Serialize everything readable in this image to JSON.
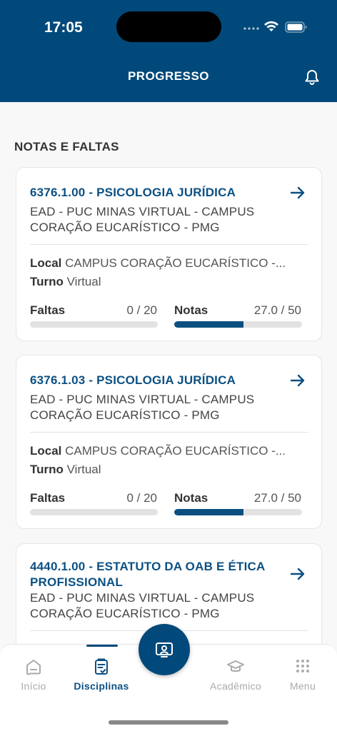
{
  "status_bar": {
    "time": "17:05"
  },
  "header": {
    "title": "PROGRESSO"
  },
  "section": {
    "title": "NOTAS E FALTAS"
  },
  "cards": [
    {
      "code_title": "6376.1.00 - PSICOLOGIA JURÍDICA",
      "campus": "EAD - PUC MINAS VIRTUAL - CAMPUS CORAÇÃO EUCARÍSTICO - PMG",
      "local_label": "Local",
      "local_value": "CAMPUS CORAÇÃO EUCARÍSTICO -...",
      "turno_label": "Turno",
      "turno_value": "Virtual",
      "faltas_label": "Faltas",
      "faltas_value": "0 / 20",
      "faltas_fraction": 0,
      "notas_label": "Notas",
      "notas_value": "27.0 / 50",
      "notas_fraction": 0.54
    },
    {
      "code_title": "6376.1.03 - PSICOLOGIA JURÍDICA",
      "campus": "EAD - PUC MINAS VIRTUAL - CAMPUS CORAÇÃO EUCARÍSTICO - PMG",
      "local_label": "Local",
      "local_value": "CAMPUS CORAÇÃO EUCARÍSTICO -...",
      "turno_label": "Turno",
      "turno_value": "Virtual",
      "faltas_label": "Faltas",
      "faltas_value": "0 / 20",
      "faltas_fraction": 0,
      "notas_label": "Notas",
      "notas_value": "27.0 / 50",
      "notas_fraction": 0.54
    },
    {
      "code_title": "4440.1.00 - ESTATUTO DA OAB E ÉTICA PROFISSIONAL",
      "campus": "EAD - PUC MINAS VIRTUAL - CAMPUS CORAÇÃO EUCARÍSTICO - PMG"
    }
  ],
  "nav": {
    "items": [
      {
        "label": "Início",
        "icon": "home-icon"
      },
      {
        "label": "Disciplinas",
        "icon": "clipboard-icon",
        "active": true
      },
      {
        "label": "Acadêmico",
        "icon": "graduation-cap-icon"
      },
      {
        "label": "Menu",
        "icon": "grid-dots-icon"
      }
    ],
    "fab_icon": "student-id-icon"
  },
  "colors": {
    "primary": "#01497a",
    "link": "#0b5083",
    "bar_bg": "#e2e2e2"
  }
}
